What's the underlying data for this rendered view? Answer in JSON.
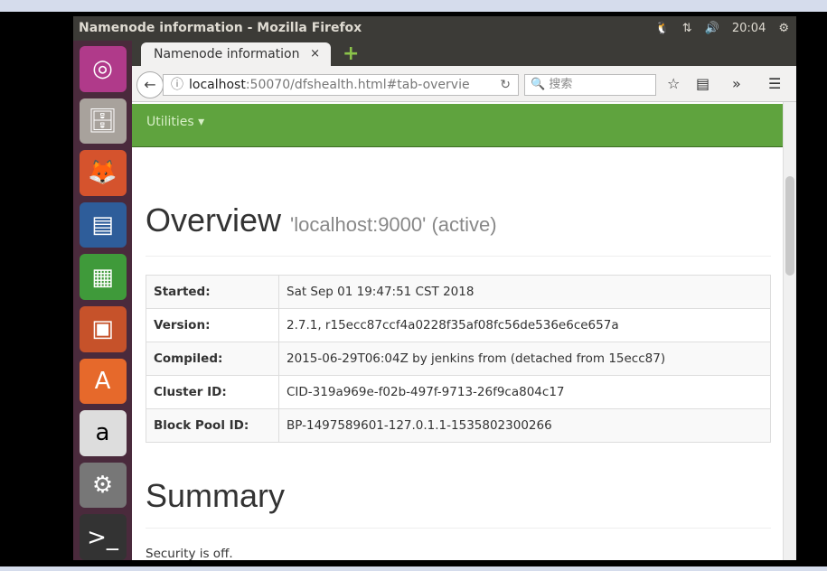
{
  "window": {
    "title": "Namenode information - Mozilla Firefox",
    "clock": "20:04"
  },
  "launcher": [
    "ubuntu-dash",
    "files",
    "firefox",
    "libreoffice-writer",
    "libreoffice-calc",
    "libreoffice-impress",
    "software-center",
    "amazon",
    "system-settings",
    "terminal"
  ],
  "tab": {
    "label": "Namenode information",
    "close": "×",
    "new": "+"
  },
  "nav": {
    "url_host": "localhost",
    "url_rest": ":50070/dfshealth.html#tab-overvie",
    "search_placeholder": "搜索"
  },
  "page": {
    "menu": "Utilities ▾",
    "title": "Overview",
    "subtitle": "'localhost:9000' (active)",
    "rows": [
      {
        "k": "Started:",
        "v": "Sat Sep 01 19:47:51 CST 2018"
      },
      {
        "k": "Version:",
        "v": "2.7.1, r15ecc87ccf4a0228f35af08fc56de536e6ce657a"
      },
      {
        "k": "Compiled:",
        "v": "2015-06-29T06:04Z by jenkins from (detached from 15ecc87)"
      },
      {
        "k": "Cluster ID:",
        "v": "CID-319a969e-f02b-497f-9713-26f9ca804c17"
      },
      {
        "k": "Block Pool ID:",
        "v": "BP-1497589601-127.0.1.1-1535802300266"
      }
    ],
    "summary": "Summary",
    "security": "Security is off."
  },
  "colors": {
    "navbar": "#5fa33e",
    "titlebar": "#3c3b37"
  }
}
